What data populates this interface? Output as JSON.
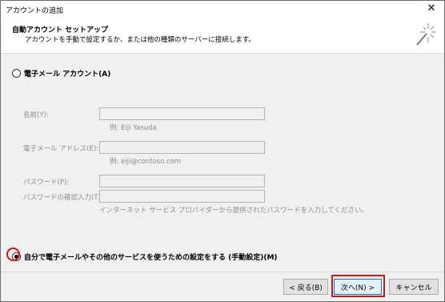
{
  "window": {
    "title": "アカウントの追加",
    "close_label": "✕"
  },
  "header": {
    "title": "自動アカウント セットアップ",
    "subtitle": "アカウントを手動で設定するか、または他の種類のサーバーに接続します。"
  },
  "options": {
    "email_account_label": "電子メール アカウント(A)",
    "manual_setup_label": "自分で電子メールやその他のサービスを使うための設定をする (手動設定)(M)",
    "selected": "manual_setup"
  },
  "form": {
    "name_label": "名前(Y):",
    "name_value": "",
    "name_hint": "例: Eiji Yasuda",
    "email_label": "電子メール アドレス(E):",
    "email_value": "",
    "email_hint": "例: eiji@contoso.com",
    "password_label": "パスワード(P):",
    "password_value": "",
    "password_confirm_label": "パスワードの確認入力(T):",
    "password_confirm_value": "",
    "password_note": "インターネット サービス プロバイダーから提供されたパスワードを入力してください。"
  },
  "footer": {
    "back_label": "< 戻る(B)",
    "next_label": "次へ(N) >",
    "cancel_label": "キャンセル"
  },
  "colors": {
    "highlight": "#d0141c",
    "content_bg": "#f0f0f0",
    "default_button_border": "#0078d7"
  }
}
